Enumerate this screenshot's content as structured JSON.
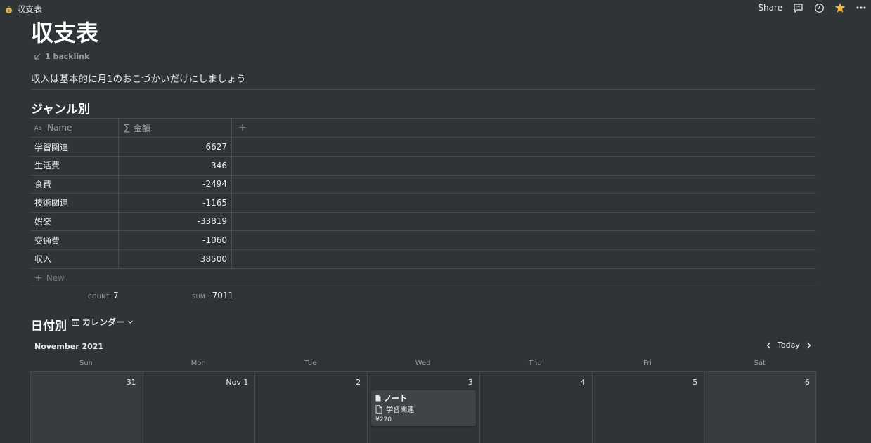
{
  "topbar": {
    "breadcrumb": "収支表",
    "share": "Share"
  },
  "page": {
    "title": "収支表",
    "backlink": "1 backlink",
    "description": "収入は基本的に月1のおこづかいだけにしましょう"
  },
  "genre": {
    "heading": "ジャンル別",
    "col_name": "Name",
    "col_amount": "金額",
    "rows": [
      {
        "name": "学習関連",
        "amount": "-6627"
      },
      {
        "name": "生活費",
        "amount": "-346"
      },
      {
        "name": "食費",
        "amount": "-2494"
      },
      {
        "name": "技術関連",
        "amount": "-1165"
      },
      {
        "name": "娯楽",
        "amount": "-33819"
      },
      {
        "name": "交通費",
        "amount": "-1060"
      },
      {
        "name": "収入",
        "amount": "38500"
      }
    ],
    "new_label": "New",
    "count_label": "COUNT",
    "count_value": "7",
    "sum_label": "SUM",
    "sum_value": "-7011"
  },
  "calendar": {
    "heading": "日付別",
    "view_label": "カレンダー",
    "month": "November 2021",
    "today": "Today",
    "days": [
      "Sun",
      "Mon",
      "Tue",
      "Wed",
      "Thu",
      "Fri",
      "Sat"
    ],
    "dates": [
      "31",
      "Nov 1",
      "2",
      "3",
      "4",
      "5",
      "6"
    ],
    "card": {
      "title": "ノート",
      "genre": "学習関連",
      "price": "¥220"
    }
  },
  "colors": {
    "background": "#2f3437",
    "border": "#474c50",
    "star": "#f5b83d"
  }
}
